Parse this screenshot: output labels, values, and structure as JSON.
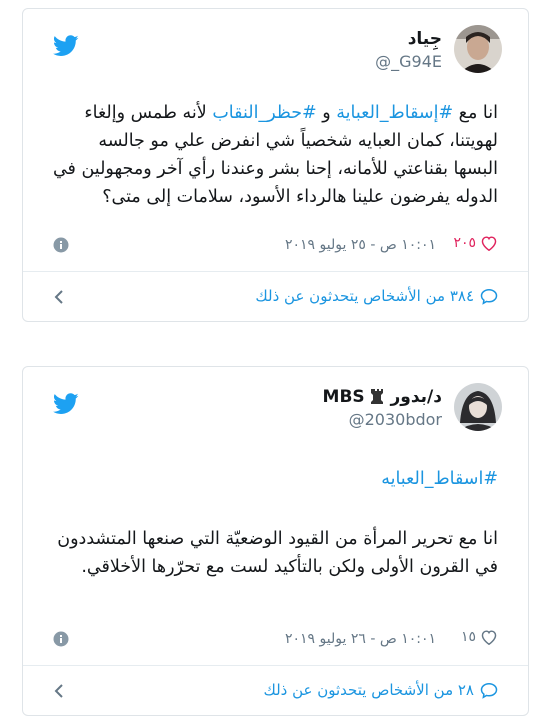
{
  "tweets": [
    {
      "display_name": "جِياد",
      "handle": "@_G94E",
      "text_prefix": "انا مع ",
      "tag1": "#إسقاط_العباية",
      "text_mid": " و ",
      "tag2": "#حظر_النقاب",
      "text_rest": " لأنه طمس وإلغاء لهويتنا، كمان العبايه شخصياً شي انفرض علي مو جالسه البسها بقناعتي للأمانه، إحنا بشر وعندنا رأي آخر ومجهولين في الدوله يفرضون علينا هالرداء الأسود، سلامات إلى متى؟",
      "likes": "٢٠٥",
      "date": "١٠:٠١ ص - ٢٥ يوليو ٢٠١٩",
      "talking": "٣٨٤ من الأشخاص يتحدثون عن ذلك"
    },
    {
      "display_name": "د/بدور",
      "name_suffix": "MBS",
      "handle": "@2030bdor",
      "hashtag": "#اسقاط_العبايه",
      "text": "انا مع تحرير المرأة من القيود الوضعيّة التي صنعها المتشددون في القرون الأولى ولكن بالتأكيد لست مع تحرّرها الأخلاقي.",
      "likes": "١٥",
      "date": "١٠:٠١ ص - ٢٦ يوليو ٢٠١٩",
      "talking": "٢٨ من الأشخاص يتحدثون عن ذلك"
    }
  ],
  "colors": {
    "accent": "#1b95e0",
    "muted": "#657786",
    "text": "#14171a",
    "border": "#dfe4e8"
  },
  "icons": [
    "twitter-bird-icon",
    "heart-icon",
    "info-icon",
    "speech-bubble-icon",
    "chevron-left-icon",
    "chess-rook-icon"
  ]
}
